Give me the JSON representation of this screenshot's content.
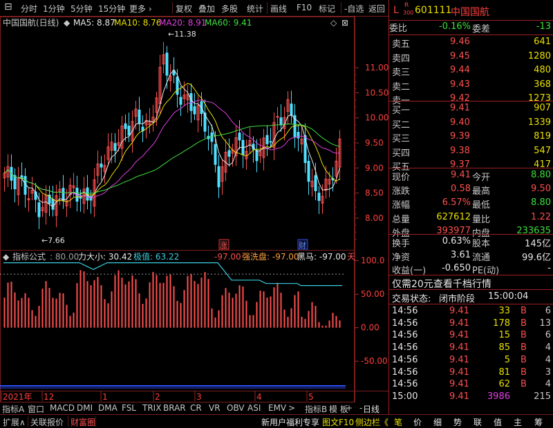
{
  "toolbar": {
    "items": [
      "分时",
      "1分钟",
      "5分钟",
      "15分钟",
      "更多 ›",
      "复权",
      "叠加",
      "多股",
      "统计",
      "画线",
      "F10",
      "标记",
      "-自选",
      "返回"
    ]
  },
  "chart_header": {
    "title": "中国国航(日线)",
    "ma5": "MA5: 8.87",
    "ma10": "MA10: 8.76",
    "ma20": "MA20: 8.91",
    "ma60": "MA60: 9.41",
    "high_mark": "11.38",
    "low_mark": "7.66"
  },
  "indicator_header": {
    "name": "指标公式",
    "p1": ": 80.00",
    "p2": "力大小: 30.42",
    "p3": "极值: 63.22",
    "p4": "-97.00",
    "p5": "强洗盘: -97.00",
    "p6": "黑马: -97.00",
    "p7": "天"
  },
  "markers": {
    "zhang": "涨",
    "cai": "财"
  },
  "x_labels": [
    "2021年",
    "12",
    "1",
    "2",
    "3",
    "4",
    "5"
  ],
  "colors": {
    "ma5": "#e8e8e8",
    "ma10": "#e8e000",
    "ma20": "#e040e0",
    "ma60": "#40e040",
    "up": "#ff5050",
    "down": "#50e0ff",
    "grid": "#7a1f1f",
    "cyan": "#3ad0e0"
  },
  "chart_data": {
    "type": "candlestick",
    "price_axis": [
      "11.00",
      "10.50",
      "10.00",
      "9.50",
      "9.00",
      "8.50",
      "8.00"
    ],
    "price_ylim": [
      7.6,
      11.8
    ],
    "indicator_axis": [
      "100.0",
      "50.00",
      "0.00",
      "-50.00"
    ],
    "indicator_ylim": [
      -90,
      110
    ]
  },
  "tabs": [
    "指标A",
    "窗口",
    "MACD",
    "DMI",
    "DMA",
    "FSL",
    "TRIX",
    "BRAR",
    "CR",
    "VR",
    "OBV",
    "ASI",
    "EMV",
    ">",
    "指标B",
    "模 板",
    "+",
    "-"
  ],
  "tab_right": "日线",
  "quote": {
    "tag_l": "L",
    "tag_r": "R",
    "tag_300": "300",
    "code": "601111",
    "name": "中国国航",
    "weibi_label": "委比",
    "weibi": "-0.16%",
    "weicha_label": "委差",
    "weicha": "-13",
    "asks": [
      {
        "label": "卖五",
        "price": "9.46",
        "vol": "641"
      },
      {
        "label": "卖四",
        "price": "9.45",
        "vol": "1280"
      },
      {
        "label": "卖三",
        "price": "9.44",
        "vol": "480"
      },
      {
        "label": "卖二",
        "price": "9.43",
        "vol": "368"
      },
      {
        "label": "卖一",
        "price": "9.42",
        "vol": "1273"
      }
    ],
    "bids": [
      {
        "label": "买一",
        "price": "9.41",
        "vol": "907"
      },
      {
        "label": "买二",
        "price": "9.40",
        "vol": "1339"
      },
      {
        "label": "买三",
        "price": "9.39",
        "vol": "819"
      },
      {
        "label": "买四",
        "price": "9.38",
        "vol": "547"
      },
      {
        "label": "买五",
        "price": "9.37",
        "vol": "417"
      }
    ],
    "stats": [
      {
        "l1": "现价",
        "v1": "9.41",
        "l2": "今开",
        "v2": "8.80"
      },
      {
        "l1": "涨跌",
        "v1": "0.58",
        "l2": "最高",
        "v2": "9.50"
      },
      {
        "l1": "涨幅",
        "v1": "6.57%",
        "l2": "最低",
        "v2": "8.80"
      },
      {
        "l1": "总量",
        "v1": "627612",
        "l2": "量比",
        "v2": "1.22"
      },
      {
        "l1": "外盘",
        "v1": "393977",
        "l2": "内盘",
        "v2": "233635"
      }
    ],
    "stats2": [
      {
        "l1": "换手",
        "v1": "0.63%",
        "l2": "股本",
        "v2": "145亿"
      },
      {
        "l1": "净资",
        "v1": "3.61",
        "l2": "流通",
        "v2": "99.6亿"
      },
      {
        "l1": "收益(一)",
        "v1": "-0.650",
        "l2": "PE(动)",
        "v2": "-"
      }
    ],
    "promo": "仅需20元查看千档行情",
    "trade_state_label": "交易状态:",
    "trade_state": "闭市阶段",
    "trade_time": "15:00:04",
    "ticks": [
      {
        "t": "14:56",
        "p": "9.41",
        "v": "33",
        "d": "B",
        "n": "6"
      },
      {
        "t": "14:56",
        "p": "9.41",
        "v": "178",
        "d": "B",
        "n": "13"
      },
      {
        "t": "14:56",
        "p": "9.41",
        "v": "15",
        "d": "B",
        "n": "6"
      },
      {
        "t": "14:56",
        "p": "9.41",
        "v": "85",
        "d": "B",
        "n": "4"
      },
      {
        "t": "14:56",
        "p": "9.41",
        "v": "5",
        "d": "B",
        "n": "4"
      },
      {
        "t": "14:56",
        "p": "9.41",
        "v": "81",
        "d": "B",
        "n": "3"
      },
      {
        "t": "14:56",
        "p": "9.41",
        "v": "62",
        "d": "B",
        "n": "4"
      },
      {
        "t": "15:00",
        "p": "9.41",
        "v": "3986",
        "d": "",
        "n": "215"
      }
    ]
  },
  "bottombar": {
    "left": [
      "扩展∧",
      "关联报价",
      "财富圈"
    ],
    "mid": "新用户福利专享",
    "mid2": "图文F10",
    "mid3": "侧边栏《",
    "right": [
      "笔",
      "价",
      "细",
      "势",
      "联",
      "值",
      "主",
      "筹"
    ]
  }
}
